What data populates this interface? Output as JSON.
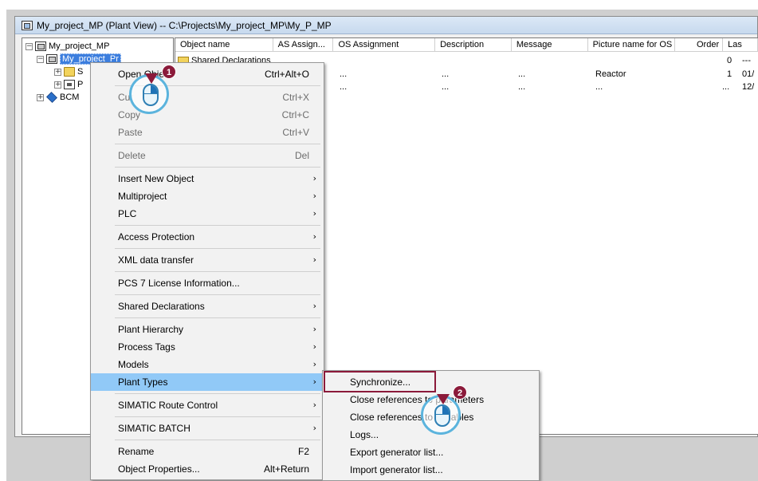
{
  "window": {
    "title": "My_project_MP (Plant View) -- C:\\Projects\\My_project_MP\\My_P_MP"
  },
  "tree": {
    "nodes": [
      {
        "label": "My_project_MP",
        "expander": "−",
        "icon": "multiproject-icon"
      },
      {
        "label": "My_project_Pr",
        "expander": "−",
        "icon": "project-icon",
        "selected": true
      },
      {
        "label": "S",
        "expander": "+",
        "icon": "folder-icon"
      },
      {
        "label": "P",
        "expander": "+",
        "icon": "plant-icon"
      },
      {
        "label": "BCM",
        "expander": "+",
        "icon": "bcm-library-icon"
      }
    ]
  },
  "list": {
    "columns": [
      "Object name",
      "AS Assign...",
      "OS Assignment",
      "Description",
      "Message",
      "Picture name for OS",
      "Order",
      "Las"
    ],
    "rows": [
      {
        "name": "Shared Declarations",
        "as": "",
        "os": "",
        "desc": "",
        "msg": "",
        "pic": "",
        "order": "0",
        "last": "---"
      },
      {
        "name": "",
        "as": "...",
        "os": "...",
        "desc": "...",
        "msg": "...",
        "pic": "Reactor",
        "order": "1",
        "last": "01/"
      },
      {
        "name": "",
        "as": "...",
        "os": "...",
        "desc": "...",
        "msg": "...",
        "pic": "...",
        "order": "...",
        "last": "12/"
      }
    ]
  },
  "context_menu": {
    "items": [
      {
        "label": "Open Object",
        "shortcut": "Ctrl+Alt+O"
      },
      {
        "label": "Cut",
        "shortcut": "Ctrl+X",
        "disabled": true
      },
      {
        "label": "Copy",
        "shortcut": "Ctrl+C",
        "disabled": true
      },
      {
        "label": "Paste",
        "shortcut": "Ctrl+V",
        "disabled": true
      },
      {
        "label": "Delete",
        "shortcut": "Del",
        "disabled": true
      },
      {
        "label": "Insert New Object",
        "submenu": true
      },
      {
        "label": "Multiproject",
        "submenu": true
      },
      {
        "label": "PLC",
        "submenu": true
      },
      {
        "label": "Access Protection",
        "submenu": true
      },
      {
        "label": "XML data transfer",
        "submenu": true
      },
      {
        "label": "PCS 7 License Information..."
      },
      {
        "label": "Shared Declarations",
        "submenu": true
      },
      {
        "label": "Plant Hierarchy",
        "submenu": true
      },
      {
        "label": "Process Tags",
        "submenu": true
      },
      {
        "label": "Models",
        "submenu": true
      },
      {
        "label": "Plant Types",
        "submenu": true,
        "highlighted": true
      },
      {
        "label": "SIMATIC Route Control",
        "submenu": true
      },
      {
        "label": "SIMATIC BATCH",
        "submenu": true
      },
      {
        "label": "Rename",
        "shortcut": "F2"
      },
      {
        "label": "Object Properties...",
        "shortcut": "Alt+Return"
      }
    ],
    "submenu_arrow": "›"
  },
  "submenu": {
    "items": [
      {
        "label": "Synchronize..."
      },
      {
        "label": "Close references to parameters"
      },
      {
        "label": "Close references to variables"
      },
      {
        "label": "Logs..."
      },
      {
        "label": "Export generator list..."
      },
      {
        "label": "Import generator list..."
      }
    ]
  },
  "callouts": {
    "step1": "1",
    "step2": "2"
  },
  "colors": {
    "highlight": "#91c9f7",
    "callout": "#8b1a3a",
    "selection": "#3c7ede"
  }
}
